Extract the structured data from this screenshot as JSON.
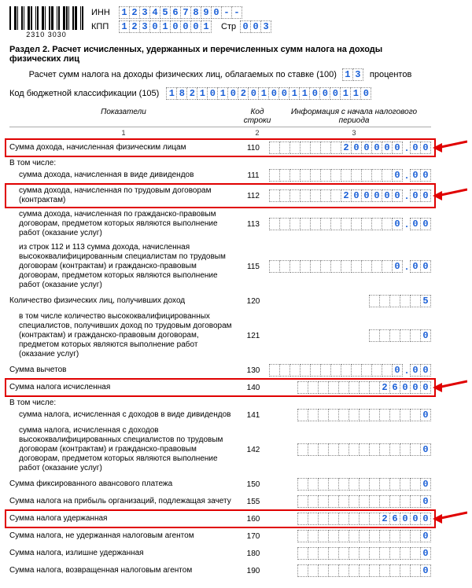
{
  "header": {
    "barcode_number": "2310 3030",
    "inn_label": "ИНН",
    "inn_value": "1234567890--",
    "kpp_label": "КПП",
    "kpp_value": "123010001",
    "page_label": "Стр",
    "page_value": "003"
  },
  "section_title": "Раздел 2. Расчет исчисленных, удержанных и перечисленных сумм налога на доходы физических лиц",
  "rate_line": {
    "text": "Расчет сумм налога на доходы физических лиц, облагаемых по ставке (100)",
    "rate": "13",
    "suffix": "процентов"
  },
  "kbk": {
    "label": "Код бюджетной классификации (105)",
    "value": "18210102010011000110"
  },
  "table_head": {
    "col1": "Показатели",
    "col2": "Код строки",
    "col3": "Информация с начала налогового периода",
    "s1": "1",
    "s2": "2",
    "s3": "3"
  },
  "rows": {
    "r110": {
      "label": "Сумма дохода, начисленная физическим лицам",
      "code": "110",
      "int": "200000",
      "dec": "00"
    },
    "in_that": "В том числе:",
    "r111": {
      "label": "сумма дохода, начисленная в виде дивидендов",
      "code": "111",
      "int": "0",
      "dec": "00"
    },
    "r112": {
      "label": "сумма дохода, начисленная по трудовым договорам (контрактам)",
      "code": "112",
      "int": "200000",
      "dec": "00"
    },
    "r113": {
      "label": "сумма дохода, начисленная по гражданско-правовым договорам, предметом которых являются выполнение работ (оказание услуг)",
      "code": "113",
      "int": "0",
      "dec": "00"
    },
    "r115": {
      "label": "из строк 112 и 113 сумма дохода, начисленная высококвалифицированным специалистам по трудовым договорам  (контрактам) и гражданско-правовым договорам, предметом которых являются выполнение работ (оказание услуг)",
      "code": "115",
      "int": "0",
      "dec": "00"
    },
    "r120": {
      "label": "Количество физических лиц, получивших доход",
      "code": "120",
      "val": "5"
    },
    "r121": {
      "label": "в том числе количество  высококвалифицированных специалистов, получивших доход по трудовым договорам (контрактам) и гражданско-правовым договорам, предметом которых являются выполнение работ (оказание услуг)",
      "code": "121",
      "val": "0"
    },
    "r130": {
      "label": "Сумма вычетов",
      "code": "130",
      "int": "0",
      "dec": "00"
    },
    "r140": {
      "label": "Сумма налога исчисленная",
      "code": "140",
      "val": "26000"
    },
    "in_that2": "В том числе:",
    "r141": {
      "label": "сумма налога, исчисленная с доходов в виде дивидендов",
      "code": "141",
      "val": "0"
    },
    "r142": {
      "label": "сумма налога, исчисленная с доходов высококвалифицированных специалистов по трудовым договорам (контрактам) и гражданско-правовым договорам, предметом которых являются выполнение работ (оказание услуг)",
      "code": "142",
      "val": "0"
    },
    "r150": {
      "label": "Сумма фиксированного авансового платежа",
      "code": "150",
      "val": "0"
    },
    "r155": {
      "label": "Сумма налога на прибыль организаций, подлежащая зачету",
      "code": "155",
      "val": "0"
    },
    "r160": {
      "label": "Сумма налога удержанная",
      "code": "160",
      "val": "26000"
    },
    "r170": {
      "label": "Сумма налога, не удержанная налоговым агентом",
      "code": "170",
      "val": "0"
    },
    "r180": {
      "label": "Сумма налога, излишне удержанная",
      "code": "180",
      "val": "0"
    },
    "r190": {
      "label": "Сумма налога, возвращенная налоговым агентом",
      "code": "190",
      "val": "0"
    }
  }
}
